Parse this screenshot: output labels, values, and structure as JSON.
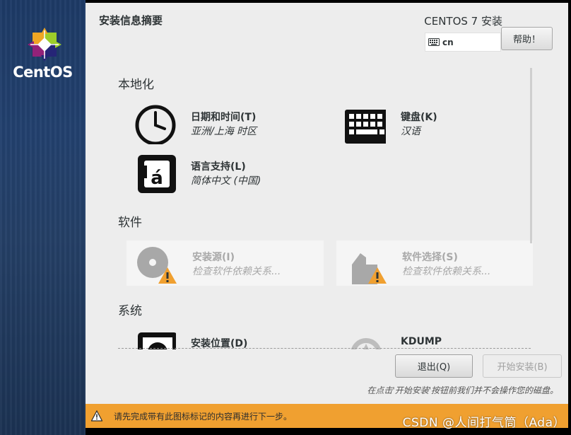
{
  "sidebar": {
    "brand": "CentOS"
  },
  "header": {
    "title": "安装信息摘要",
    "product": "CENTOS 7 安装",
    "keyboard_layout": "cn",
    "help_label": "帮助！"
  },
  "localization": {
    "heading": "本地化",
    "datetime": {
      "title": "日期和时间(T)",
      "status": "亚洲/上海 时区"
    },
    "keyboard": {
      "title": "键盘(K)",
      "status": "汉语"
    },
    "language": {
      "title": "语言支持(L)",
      "status": "简体中文 (中国)"
    }
  },
  "software": {
    "heading": "软件",
    "source": {
      "title": "安装源(I)",
      "status": "检查软件依赖关系..."
    },
    "selection": {
      "title": "软件选择(S)",
      "status": "检查软件依赖关系..."
    }
  },
  "system": {
    "heading": "系统",
    "destination": {
      "title": "安装位置(D)"
    },
    "kdump": {
      "title": "KDUMP"
    }
  },
  "footer": {
    "quit_label": "退出(Q)",
    "begin_label": "开始安装(B)",
    "note": "在点击'开始安装'按钮前我们并不会操作您的磁盘。"
  },
  "warning_bar": {
    "text": "请先完成带有此图标标记的内容再进行下一步。"
  },
  "watermark": "CSDN @人间打气筒（Ada）",
  "colors": {
    "warning": "#f0a030",
    "sidebar": "#1d3a66",
    "background": "#ededed"
  }
}
